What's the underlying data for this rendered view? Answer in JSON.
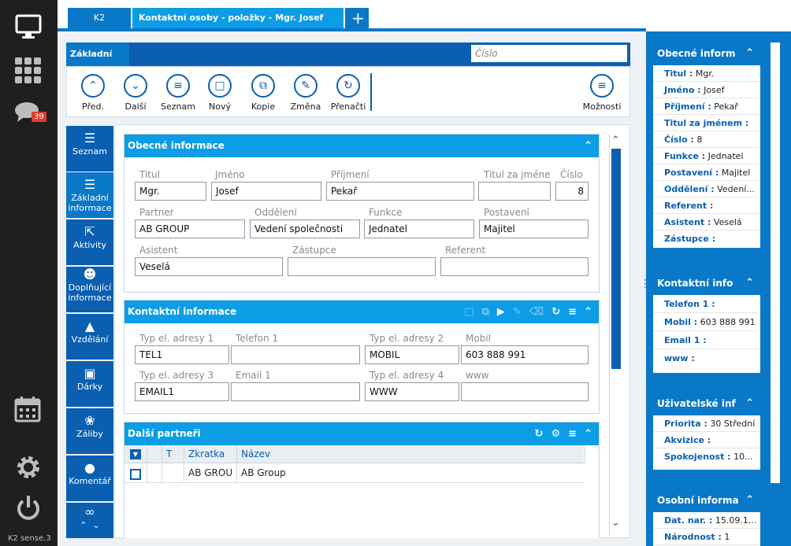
{
  "app": {
    "footer": "K2 sense.3",
    "notification_count": "39"
  },
  "tabs": [
    {
      "label": "K2"
    },
    {
      "label": "Kontaktní osoby - položky - Mgr. Josef Pekař"
    },
    {
      "label": "+"
    }
  ],
  "toolbar": {
    "title": "Základní akce",
    "search_placeholder": "Číslo",
    "buttons": [
      "Před.",
      "Další",
      "Seznam",
      "Nový",
      "Kopie",
      "Změna",
      "Přenačti"
    ],
    "options": "Možnosti"
  },
  "sidenav": [
    {
      "label": "Seznam"
    },
    {
      "label": "Základní informace"
    },
    {
      "label": "Aktivity"
    },
    {
      "label": "Doplňující informace"
    },
    {
      "label": "Vzdělání"
    },
    {
      "label": "Dárky"
    },
    {
      "label": "Záliby"
    },
    {
      "label": "Komentář"
    }
  ],
  "general": {
    "title": "Obecné informace",
    "titul_label": "Titul",
    "titul": "Mgr.",
    "jmeno_label": "Jméno",
    "jmeno": "Josef",
    "prijmeni_label": "Příjmení",
    "prijmeni": "Pekař",
    "titul_za_label": "Titul za jménem",
    "titul_za": "",
    "cislo_label": "Číslo",
    "cislo": "8",
    "partner_label": "Partner",
    "partner": "AB GROUP",
    "oddeleni_label": "Oddělení",
    "oddeleni": "Vedení společnosti",
    "funkce_label": "Funkce",
    "funkce": "Jednatel",
    "postaveni_label": "Postavení",
    "postaveni": "Majitel",
    "asistent_label": "Asistent",
    "asistent": "Veselá",
    "zastupce_label": "Zástupce",
    "zastupce": "",
    "referent_label": "Referent",
    "referent": ""
  },
  "contact": {
    "title": "Kontaktní informace",
    "typ1_label": "Typ el. adresy 1",
    "typ1": "TEL1",
    "tel1_label": "Telefon 1",
    "tel1": "",
    "typ2_label": "Typ el. adresy 2",
    "typ2": "MOBIL",
    "mobil_label": "Mobil",
    "mobil": "603 888 991",
    "typ3_label": "Typ el. adresy 3",
    "typ3": "EMAIL1",
    "email1_label": "Email 1",
    "email1": "",
    "typ4_label": "Typ el. adresy 4",
    "typ4": "WWW",
    "www_label": "www",
    "www": ""
  },
  "partners": {
    "title": "Další partneři",
    "col_t": "T",
    "col_zkratka": "Zkratka",
    "col_nazev": "Název",
    "rows": [
      {
        "zkratka": "AB GROU",
        "nazev": "AB Group"
      }
    ]
  },
  "right": {
    "general": {
      "title": "Obecné inform",
      "rows": [
        {
          "k": "Titul :",
          "v": "Mgr."
        },
        {
          "k": "Jméno :",
          "v": "Josef"
        },
        {
          "k": "Příjmení :",
          "v": "Pekař"
        },
        {
          "k": "Titul za jménem :",
          "v": ""
        },
        {
          "k": "Číslo :",
          "v": "8"
        },
        {
          "k": "Funkce :",
          "v": "Jednatel"
        },
        {
          "k": "Postavení :",
          "v": "Majitel"
        },
        {
          "k": "Oddělení :",
          "v": "Vedení..."
        },
        {
          "k": "Referent :",
          "v": ""
        },
        {
          "k": "Asistent :",
          "v": "Veselá"
        },
        {
          "k": "Zástupce :",
          "v": ""
        }
      ]
    },
    "contact": {
      "title": "Kontaktní info",
      "rows": [
        {
          "k": "Telefon 1 :",
          "v": ""
        },
        {
          "k": "Mobil :",
          "v": "603 888 991"
        },
        {
          "k": "Email 1 :",
          "v": ""
        },
        {
          "k": "www :",
          "v": ""
        }
      ]
    },
    "user": {
      "title": "Uživatelské inf",
      "rows": [
        {
          "k": "Priorita :",
          "v": "30 Střední"
        },
        {
          "k": "Akvizice :",
          "v": ""
        },
        {
          "k": "Spokojenost :",
          "v": "10..."
        }
      ]
    },
    "personal": {
      "title": "Osobní informa",
      "rows": [
        {
          "k": "Dat. nar. :",
          "v": "15.09.1..."
        },
        {
          "k": "Národnost :",
          "v": "1"
        }
      ]
    }
  }
}
